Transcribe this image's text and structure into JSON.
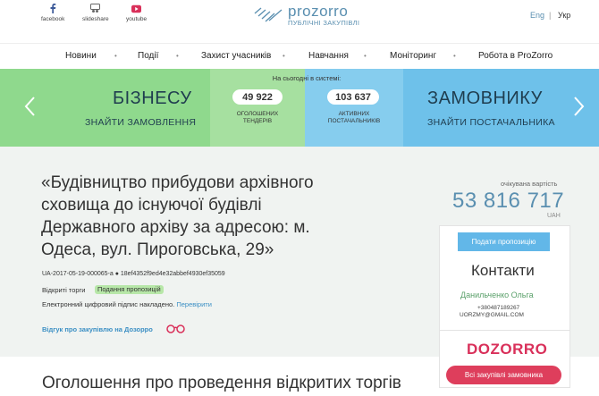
{
  "social": [
    {
      "label": "facebook",
      "icon": "facebook-icon"
    },
    {
      "label": "slideshare",
      "icon": "slideshare-icon"
    },
    {
      "label": "youtube",
      "icon": "youtube-icon"
    }
  ],
  "logo": {
    "name": "prozorro",
    "sub": "ПУБЛІЧНІ ЗАКУПІВЛІ"
  },
  "lang": {
    "eng": "Eng",
    "sep": "|",
    "ukr": "Укр"
  },
  "nav": [
    "Новини",
    "Події",
    "Захист учасників",
    "Навчання",
    "Моніторинг",
    "Робота в ProZorro"
  ],
  "hero": {
    "business_title": "БІЗНЕСУ",
    "business_sub": "ЗНАЙТИ ЗАМОВЛЕННЯ",
    "today": "На сьогодні в системі:",
    "tenders_count": "49 922",
    "tenders_label_1": "ОГОЛОШЕНИХ",
    "tenders_label_2": "ТЕНДЕРІВ",
    "suppliers_count": "103 637",
    "suppliers_label_1": "АКТИВНИХ",
    "suppliers_label_2": "ПОСТАЧАЛЬНИКІВ",
    "customer_title": "ЗАМОВНИКУ",
    "customer_sub": "ЗНАЙТИ ПОСТАЧАЛЬНИКА"
  },
  "tender": {
    "title": "«Будівництво прибудови архівного сховища до існуючої будівлі Державного архіву за адресою: м. Одеса, вул. Пироговська, 29»",
    "id_line": "UA-2017-05-19-000065-a ● 18ef4352f9ed4e32abbef4930ef35059",
    "type": "Відкриті торги",
    "status": "Подання пропозицій",
    "signature": "Електронний цифровий підпис накладено.",
    "check": "Перевірити",
    "dozorro_link": "Відгук про закупівлю на Дозорро"
  },
  "price": {
    "label": "очікувана вартість",
    "value": "53 816 717",
    "currency": "UAH"
  },
  "card": {
    "submit": "Подати пропозицію",
    "contacts_title": "Контакти",
    "name": "Данильченко Ольга",
    "phone": "+380487189267",
    "email": "UORZMY@GMAIL.COM",
    "dozorro": "DOZORRO",
    "all_purchases": "Всі закупівлі замовника"
  },
  "announce": "Оголошення про проведення відкритих торгів"
}
